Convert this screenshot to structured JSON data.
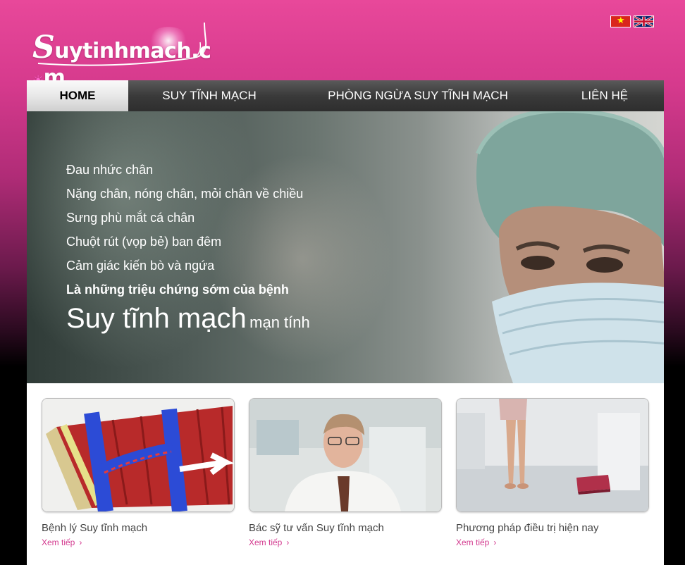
{
  "logo": {
    "text": "Suytinhmach.com",
    "s": "S",
    "rest": "uytinhmach.c",
    "o": "☀",
    "m": "m"
  },
  "flags": [
    {
      "name": "vietnamese-flag"
    },
    {
      "name": "english-flag"
    }
  ],
  "nav": {
    "items": [
      {
        "label": "HOME",
        "active": true
      },
      {
        "label": "SUY TĨNH MẠCH",
        "active": false
      },
      {
        "label": "PHÒNG NGỪA SUY TĨNH MẠCH",
        "active": false
      },
      {
        "label": "LIÊN HỆ",
        "active": false
      }
    ]
  },
  "banner": {
    "symptoms": [
      "Đau nhức chân",
      "Nặng chân, nóng chân, mỏi chân về chiều",
      "Sưng phù mắt cá chân",
      "Chuột rút (vọp bẻ) ban đêm",
      "Cảm giác kiến bò và ngứa"
    ],
    "bold_line": "Là những triệu chứng sớm của bệnh",
    "headline_big": "Suy tĩnh mạch",
    "headline_small": "mạn tính"
  },
  "cards": [
    {
      "title": "Bệnh lý Suy tĩnh mạch",
      "more": "Xem tiếp"
    },
    {
      "title": "Bác sỹ tư vấn Suy tĩnh mạch",
      "more": "Xem tiếp"
    },
    {
      "title": "Phương pháp điều trị hiện nay",
      "more": "Xem tiếp"
    }
  ],
  "colors": {
    "accent": "#d33a8f",
    "nav_bg": "#3a3a3a",
    "header_pink": "#e8489a"
  }
}
